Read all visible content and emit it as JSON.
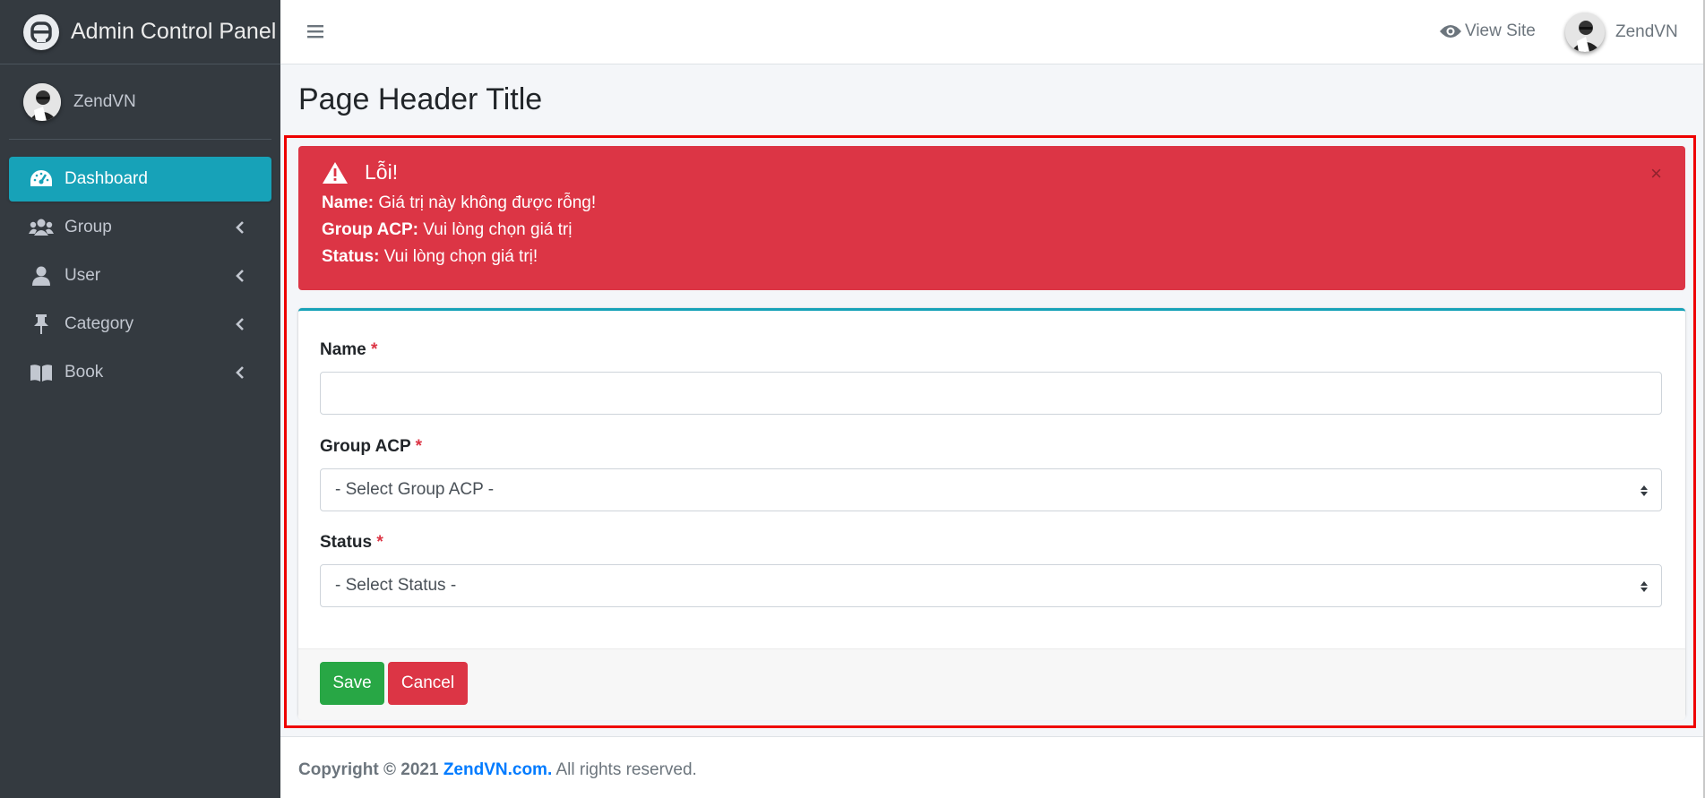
{
  "sidebar": {
    "brand": "Admin Control Panel",
    "user_name": "ZendVN",
    "items": [
      {
        "label": "Dashboard",
        "icon": "dashboard-icon",
        "active": true
      },
      {
        "label": "Group",
        "icon": "users-icon"
      },
      {
        "label": "User",
        "icon": "user-icon"
      },
      {
        "label": "Category",
        "icon": "thumbtack-icon"
      },
      {
        "label": "Book",
        "icon": "book-icon"
      }
    ]
  },
  "topbar": {
    "view_site": "View Site",
    "user_name": "ZendVN"
  },
  "page": {
    "title": "Page Header Title"
  },
  "alert": {
    "title": "Lỗi!",
    "errors": [
      {
        "field": "Name:",
        "message": "Giá trị này không được rỗng!"
      },
      {
        "field": "Group ACP:",
        "message": "Vui lòng chọn giá trị"
      },
      {
        "field": "Status:",
        "message": "Vui lòng chọn giá trị!"
      }
    ],
    "close": "×"
  },
  "form": {
    "name_label": "Name",
    "name_value": "",
    "group_label": "Group ACP",
    "group_selected": "- Select Group ACP -",
    "status_label": "Status",
    "status_selected": "- Select Status -",
    "required_mark": "*",
    "save_label": "Save",
    "cancel_label": "Cancel"
  },
  "footer": {
    "copyright": "Copyright © 2021",
    "site": "ZendVN.com.",
    "rights": "All rights reserved."
  },
  "colors": {
    "sidebar_bg": "#343a40",
    "active_item": "#17a2b8",
    "danger": "#dc3545",
    "success": "#28a745",
    "link": "#007bff"
  }
}
